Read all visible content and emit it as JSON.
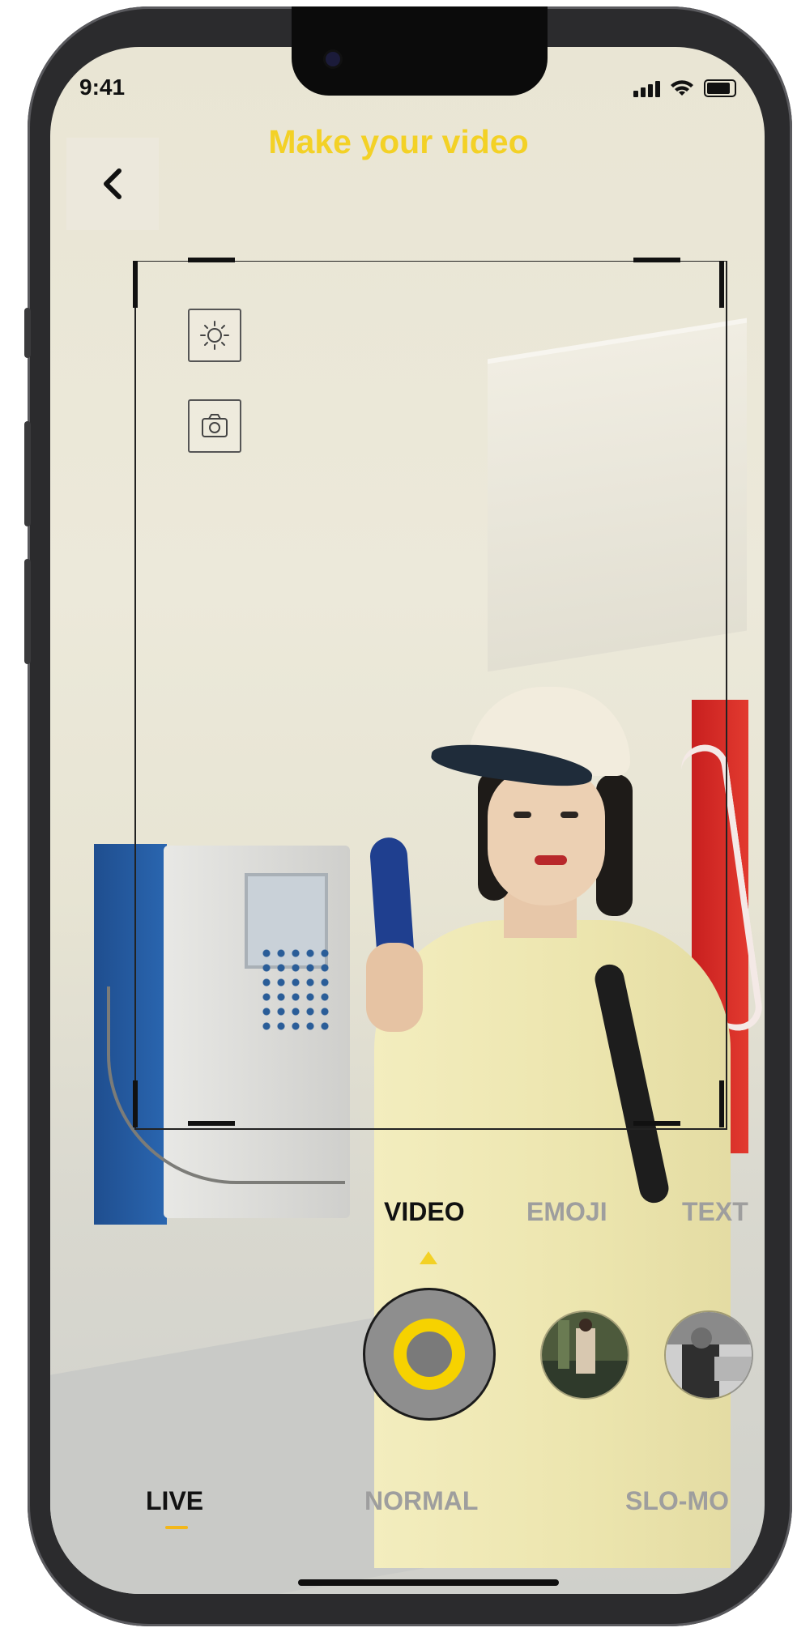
{
  "status": {
    "time": "9:41"
  },
  "header": {
    "title": "Make your video",
    "back_icon": "chevron-left-icon"
  },
  "tools": [
    {
      "name": "brightness",
      "icon": "sun-icon"
    },
    {
      "name": "camera",
      "icon": "camera-icon"
    }
  ],
  "capture_modes": {
    "items": [
      "VIDEO",
      "EMOJI",
      "TEXT"
    ],
    "selected": "VIDEO",
    "selected_color": "#111111",
    "inactive_color": "#9e9e9e"
  },
  "shutter": {
    "ring_color": "#f6d200",
    "fill_color": "#8e8e8e"
  },
  "thumbnails": [
    {
      "name": "recent-clip-1"
    },
    {
      "name": "recent-clip-2"
    }
  ],
  "speed_modes": {
    "items": [
      "LIVE",
      "NORMAL",
      "SLO-MO"
    ],
    "selected": "LIVE",
    "indicator_color": "#f3b71a"
  },
  "colors": {
    "accent": "#f3d126"
  }
}
